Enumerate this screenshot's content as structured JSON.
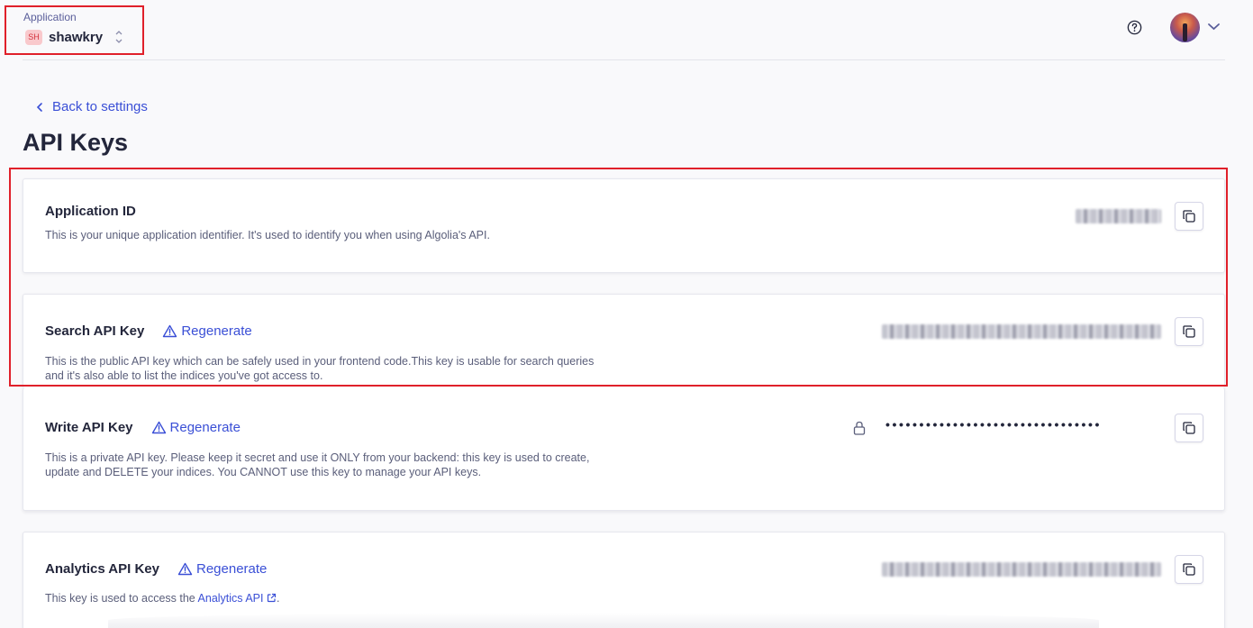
{
  "header": {
    "app_label": "Application",
    "app_badge": "SH",
    "app_name": "shawkry"
  },
  "nav": {
    "back_label": "Back to settings"
  },
  "page": {
    "title": "API Keys"
  },
  "cards": {
    "app_id": {
      "title": "Application ID",
      "description": "This is your unique application identifier. It's used to identify you when using Algolia's API."
    },
    "search": {
      "title": "Search API Key",
      "regenerate": "Regenerate",
      "description_line1": "This is the public API key which can be safely used in your frontend code.This key is usable for search queries",
      "description_line2": "and it's also able to list the indices you've got access to."
    },
    "write": {
      "title": "Write API Key",
      "regenerate": "Regenerate",
      "masked_value": "••••••••••••••••••••••••••••••••",
      "description_line1": "This is a private API key. Please keep it secret and use it ONLY from your backend: this key is used to create,",
      "description_line2": "update and DELETE your indices. You CANNOT use this key to manage your API keys."
    },
    "analytics": {
      "title": "Analytics API Key",
      "regenerate": "Regenerate",
      "description_prefix": "This key is used to access the ",
      "description_link": "Analytics API",
      "description_suffix": "."
    }
  },
  "colors": {
    "accent": "#3a4fd6",
    "highlight": "#e0202a",
    "text": "#23263b"
  },
  "icons": {
    "help": "help-circle-icon",
    "copy": "copy-icon",
    "warning": "warning-triangle-icon",
    "lock": "lock-icon",
    "external": "external-link-icon"
  }
}
